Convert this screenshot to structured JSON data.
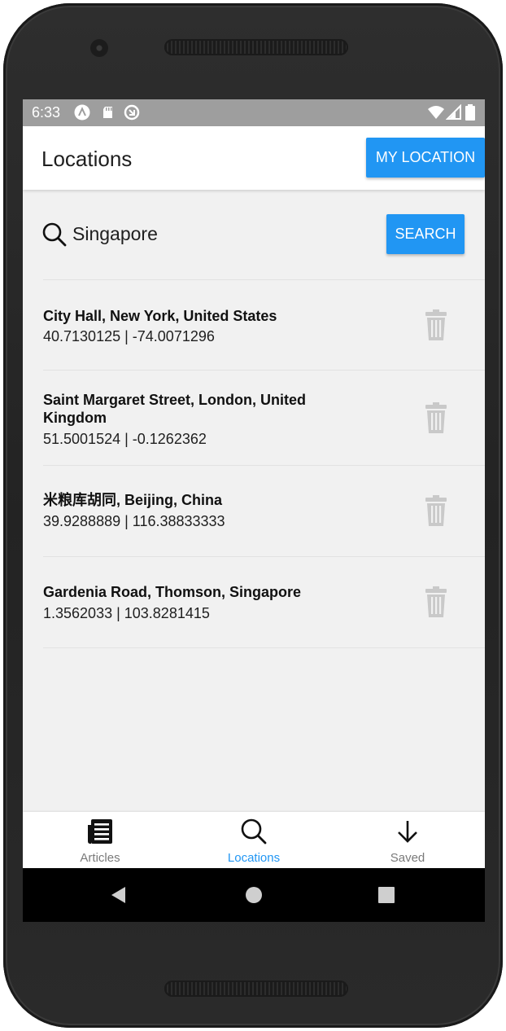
{
  "status_bar": {
    "time": "6:33",
    "icons": [
      "android-icon",
      "sd-card-icon",
      "sync-icon",
      "wifi-icon",
      "signal-icon",
      "battery-icon"
    ]
  },
  "app_bar": {
    "title": "Locations",
    "my_location_label": "MY LOCATION"
  },
  "search": {
    "value": "Singapore",
    "button_label": "SEARCH"
  },
  "locations": [
    {
      "name": "City Hall, New York, United States",
      "coords": "40.7130125 | -74.0071296"
    },
    {
      "name": "Saint Margaret Street, London, United Kingdom",
      "coords": "51.5001524 | -0.1262362"
    },
    {
      "name": "米粮库胡同, Beijing, China",
      "coords": "39.9288889 | 116.38833333"
    },
    {
      "name": "Gardenia Road, Thomson, Singapore",
      "coords": "1.3562033 | 103.8281415"
    }
  ],
  "bottom_nav": {
    "tabs": [
      {
        "label": "Articles",
        "icon": "newspaper-icon",
        "active": false
      },
      {
        "label": "Locations",
        "icon": "search-icon",
        "active": true
      },
      {
        "label": "Saved",
        "icon": "download-arrow-icon",
        "active": false
      }
    ]
  },
  "colors": {
    "accent": "#2196f3",
    "inactive_tab": "#7a7a7a",
    "trash": "#c9c9c9",
    "status_bar": "#9e9e9e"
  }
}
